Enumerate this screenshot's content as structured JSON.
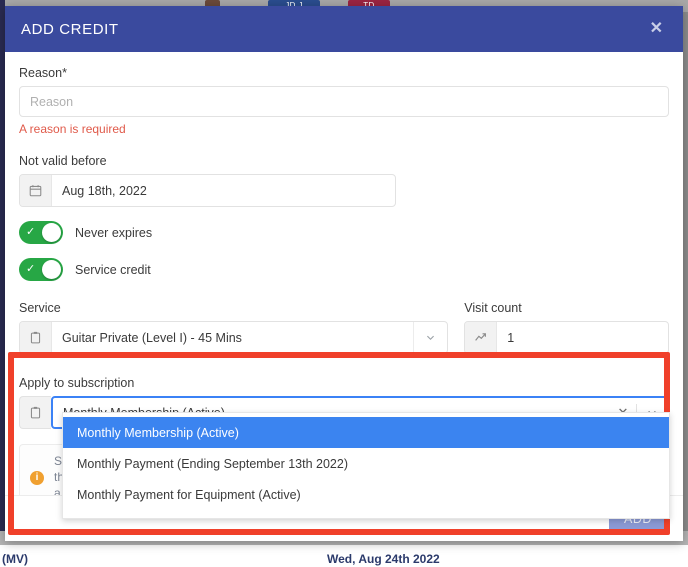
{
  "background": {
    "badge_blue": "JD J",
    "badge_red": "TD",
    "date_text": "Wed, Aug 24th 2022",
    "left_text": "(MV)"
  },
  "modal": {
    "title": "ADD CREDIT",
    "close_label": "✕",
    "reason": {
      "label": "Reason*",
      "placeholder": "Reason",
      "value": "",
      "error": "A reason is required"
    },
    "not_valid_before": {
      "label": "Not valid before",
      "value": "Aug 18th, 2022",
      "icon": "calendar-icon"
    },
    "toggles": [
      {
        "label": "Never expires",
        "state": "on",
        "color": "#27a745"
      },
      {
        "label": "Service credit",
        "state": "on",
        "color": "#27a745"
      }
    ],
    "service": {
      "label": "Service",
      "value": "Guitar Private (Level I) - 45 Mins",
      "icon": "clipboard-icon",
      "caret": "chevron-down-icon"
    },
    "visit_count": {
      "label": "Visit count",
      "value": "1",
      "icon": "trending-up-icon"
    },
    "subscription": {
      "label": "Apply to subscription",
      "value": "Monthly Membership (Active)",
      "icon": "clipboard-icon",
      "clear_label": "✕",
      "caret": "chevron-down-icon",
      "options": [
        {
          "label": "Monthly Membership (Active)",
          "selected": true
        },
        {
          "label": "Monthly Payment (Ending September 13th 2022)",
          "selected": false
        },
        {
          "label": "Monthly Payment for Equipment (Active)",
          "selected": false
        }
      ]
    },
    "info": {
      "icon": "info-icon",
      "lines": "S\nth\na\nS"
    },
    "footer": {
      "add_label": "ADD"
    }
  },
  "annotation": {
    "color": "#f0402a"
  }
}
